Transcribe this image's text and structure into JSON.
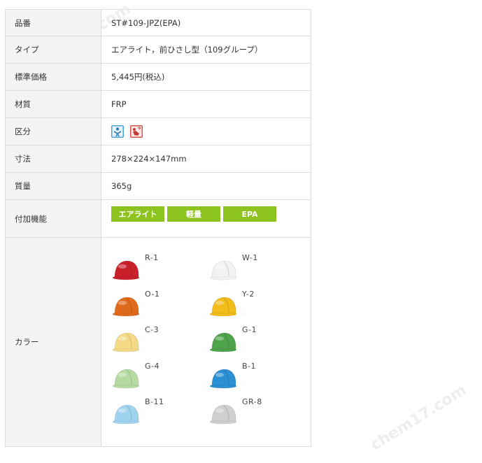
{
  "rows": {
    "hinban": {
      "label": "品番",
      "value": "ST#109-JPZ(EPA)"
    },
    "type": {
      "label": "タイプ",
      "value": "エアライト，前ひさし型（109グループ）"
    },
    "price": {
      "label": "標準価格",
      "value": "5,445円(税込)"
    },
    "material": {
      "label": "材質",
      "value": "FRP"
    },
    "category": {
      "label": "区分",
      "icons": [
        "fall-protection-icon",
        "flying-object-protection-icon"
      ]
    },
    "size": {
      "label": "寸法",
      "value": "278×224×147mm"
    },
    "weight": {
      "label": "質量",
      "value": "365g"
    },
    "features": {
      "label": "付加機能",
      "tags": [
        "エアライト",
        "軽量",
        "EPA"
      ]
    },
    "colors": {
      "label": "カラー",
      "items": [
        {
          "code": "R-1",
          "color": "#c9202c"
        },
        {
          "code": "W-1",
          "color": "#f2f2f2"
        },
        {
          "code": "O-1",
          "color": "#e06a1b"
        },
        {
          "code": "Y-2",
          "color": "#f2bc1a"
        },
        {
          "code": "C-3",
          "color": "#f4da86"
        },
        {
          "code": "G-1",
          "color": "#4ea24a"
        },
        {
          "code": "G-4",
          "color": "#b6dba2"
        },
        {
          "code": "B-1",
          "color": "#2a8fd3"
        },
        {
          "code": "B-11",
          "color": "#9fd3ee"
        },
        {
          "code": "GR-8",
          "color": "#cfcfcf"
        }
      ]
    }
  },
  "accent_color": "#8cc31f",
  "watermark": "chem17.com"
}
